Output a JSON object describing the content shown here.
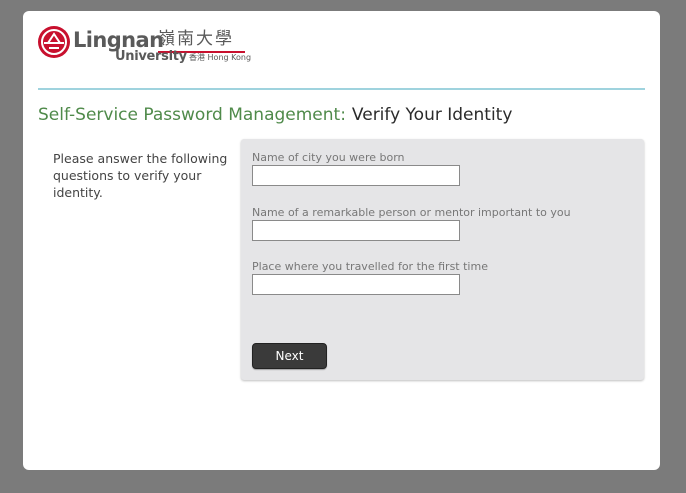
{
  "logo": {
    "name_en": "Lingnan",
    "name_cn": "嶺南大學",
    "university": "University",
    "location": "香港 Hong Kong",
    "brand_color": "#c8102e"
  },
  "page": {
    "title_prefix": "Self-Service Password Management:",
    "title_main": "Verify Your Identity",
    "instructions": "Please answer the following questions to verify your identity."
  },
  "questions": [
    {
      "label": "Name of city you were born",
      "value": ""
    },
    {
      "label": "Name of a remarkable person or mentor important to you",
      "value": ""
    },
    {
      "label": "Place where you travelled for the first time",
      "value": ""
    }
  ],
  "actions": {
    "next_label": "Next"
  },
  "colors": {
    "background": "#7b7b7b",
    "title_accent": "#4f8a4a",
    "divider": "#9fd3de",
    "button": "#3a3a3a"
  }
}
